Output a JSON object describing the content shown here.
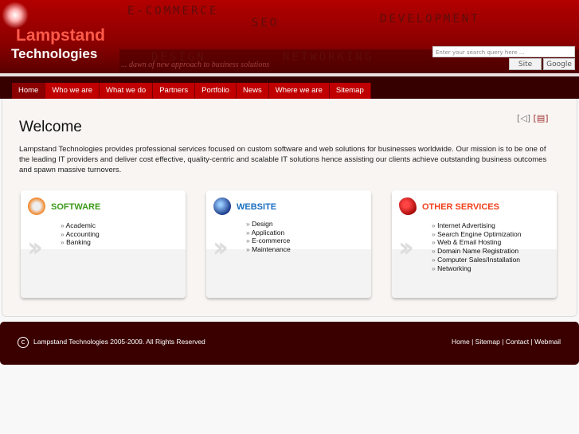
{
  "header": {
    "logo_line1": "Lampstand",
    "logo_line2": "Technologies",
    "tagline": "... dawn of new approach to business solutions",
    "watermarks": [
      "E-COMMERCE",
      "SEO",
      "DEVELOPMENT",
      "DESIGN",
      "NETWORKING"
    ],
    "search_placeholder": "Enter your search query here ...",
    "site_button": "Site",
    "google_button": "Google"
  },
  "nav": [
    "Home",
    "Who we are",
    "What we do",
    "Partners",
    "Portfolio",
    "News",
    "Where we are",
    "Sitemap"
  ],
  "main": {
    "title": "Welcome",
    "intro": "Lampstand Technologies provides professional services focused on custom software and web solutions for businesses worldwide. Our mission is to be one of the leading IT providers and deliver cost effective, quality-centric and scalable IT solutions hence assisting our clients achieve outstanding business outcomes and spawn massive turnovers.",
    "cards": [
      {
        "title": "SOFTWARE",
        "color": "#3c9a1a",
        "items": [
          "Academic",
          "Accounting",
          "Banking"
        ]
      },
      {
        "title": "WEBSITE",
        "color": "#1a6fc0",
        "items": [
          "Design",
          "Application",
          "E-commerce",
          "Maintenance"
        ]
      },
      {
        "title": "OTHER SERVICES",
        "color": "#f0401a",
        "items": [
          "Internet Advertising",
          "Search Engine Optimization",
          "Web & Email Hosting",
          "Domain Name Registration",
          "Computer Sales/Installation",
          "Networking"
        ]
      }
    ]
  },
  "footer": {
    "copyright": "Lampstand Technologies 2005-2009. All Rights Reserved",
    "links": [
      "Home",
      "Sitemap",
      "Contact",
      "Webmail"
    ],
    "separator": "|"
  }
}
